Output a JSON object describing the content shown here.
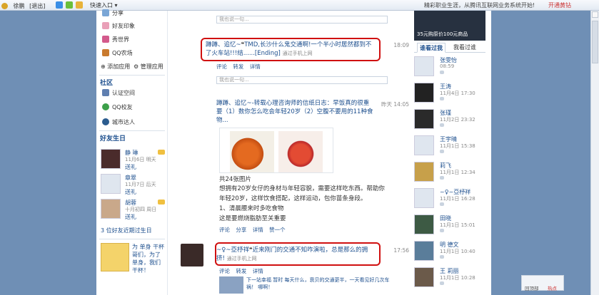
{
  "topbar": {
    "user": "徐鹏",
    "logout": "[退出]",
    "quick_entry": "快速入口",
    "slogan": "精彩职业生涯，从腾讯互联网业务系统开始!",
    "open_diamond": "开通黄钻"
  },
  "left": {
    "apps": [
      "分享",
      "好友印象",
      "秀世界",
      "QQ农场"
    ],
    "add_app": "添加应用",
    "manage_app": "管理应用",
    "community_title": "社区",
    "community": [
      "认证空间",
      "QQ校友",
      "城市达人"
    ],
    "birthday_title": "好友生日",
    "birthdays": [
      {
        "name": "静 琳",
        "date": "11月6日 明天",
        "gift": "送礼"
      },
      {
        "name": "章翠",
        "date": "11月7日 后天",
        "gift": "送礼"
      },
      {
        "name": "胡蓉",
        "date": "十月初四 周日",
        "gift": "送礼"
      }
    ],
    "recent_birthdays": "3 位好友近期过生日",
    "promo": "为 单身 干杯 哥们，为了单身，我们干杯！"
  },
  "feed": {
    "comment_placeholder": "我也说一句...",
    "post1": {
      "author": "蹲蹲、追忆~",
      "text": "TMD,长沙什么鬼交通啊!一个半小时居然都到不了火车站!!!结......[Ending]",
      "via": "通过手机上网",
      "time": "18:09",
      "actions": "评论 转发 详情"
    },
    "post2": {
      "author": "蹲蹲、追忆~",
      "title_text": "转载心理咨询师的信纸日志：早饭真的很重要（1）数你怎么吃会年轻20岁（2）空腹不要用的11种食物...",
      "time": "昨天 14:05",
      "image_count": "共24张图片",
      "body": [
        "想拥有20岁女仔的身材与年轻容貌，需要这样吃东西。帮助你年轻20岁，这样饮食搭配，这样运动，包你苗条身段。",
        "1、清晨腰来时多吃食物",
        "这是要燃烧脂肪至关重要"
      ],
      "actions": "评论 分享 详情 赞一个"
    },
    "post3": {
      "author": "~♀~亞杼祥",
      "text": "近来刚门的交通不知咋演啦，总是那么的拥挤!",
      "via": "通过手机上网",
      "time": "17:56",
      "actions": "评论 转发 详情"
    },
    "share": "下一站幸福 暂时 每天什么，衰贝的交通更半，一天看见好几次车祸！ 哪啊！"
  },
  "right": {
    "ad_text": "35元购原价100元商品",
    "tab_visited": "谁看过我",
    "tab_mine": "我看过谁",
    "visitors": [
      {
        "name": "张雯怡",
        "time": "08:59"
      },
      {
        "name": "王涛",
        "time": "11月4日 17:30"
      },
      {
        "name": "张瑾",
        "time": "11月2日 23:32"
      },
      {
        "name": "王宇晴",
        "time": "11月1日 15:38"
      },
      {
        "name": "莉飞",
        "time": "11月1日 12:34"
      },
      {
        "name": "~♀~亞杼祥",
        "time": "11月1日 16:28"
      },
      {
        "name": "田晓",
        "time": "11月1日 15:01"
      },
      {
        "name": "明 德文",
        "time": "11月1日 10:40"
      },
      {
        "name": "王 莉丽",
        "time": "11月1日 10:28"
      }
    ]
  },
  "bottom": {
    "back_top": "回顶部",
    "hot": "热点"
  },
  "colors": {
    "link": "#1d4f8e",
    "highlight_box": "#d01010",
    "page_bg": "#6f8fb5"
  }
}
